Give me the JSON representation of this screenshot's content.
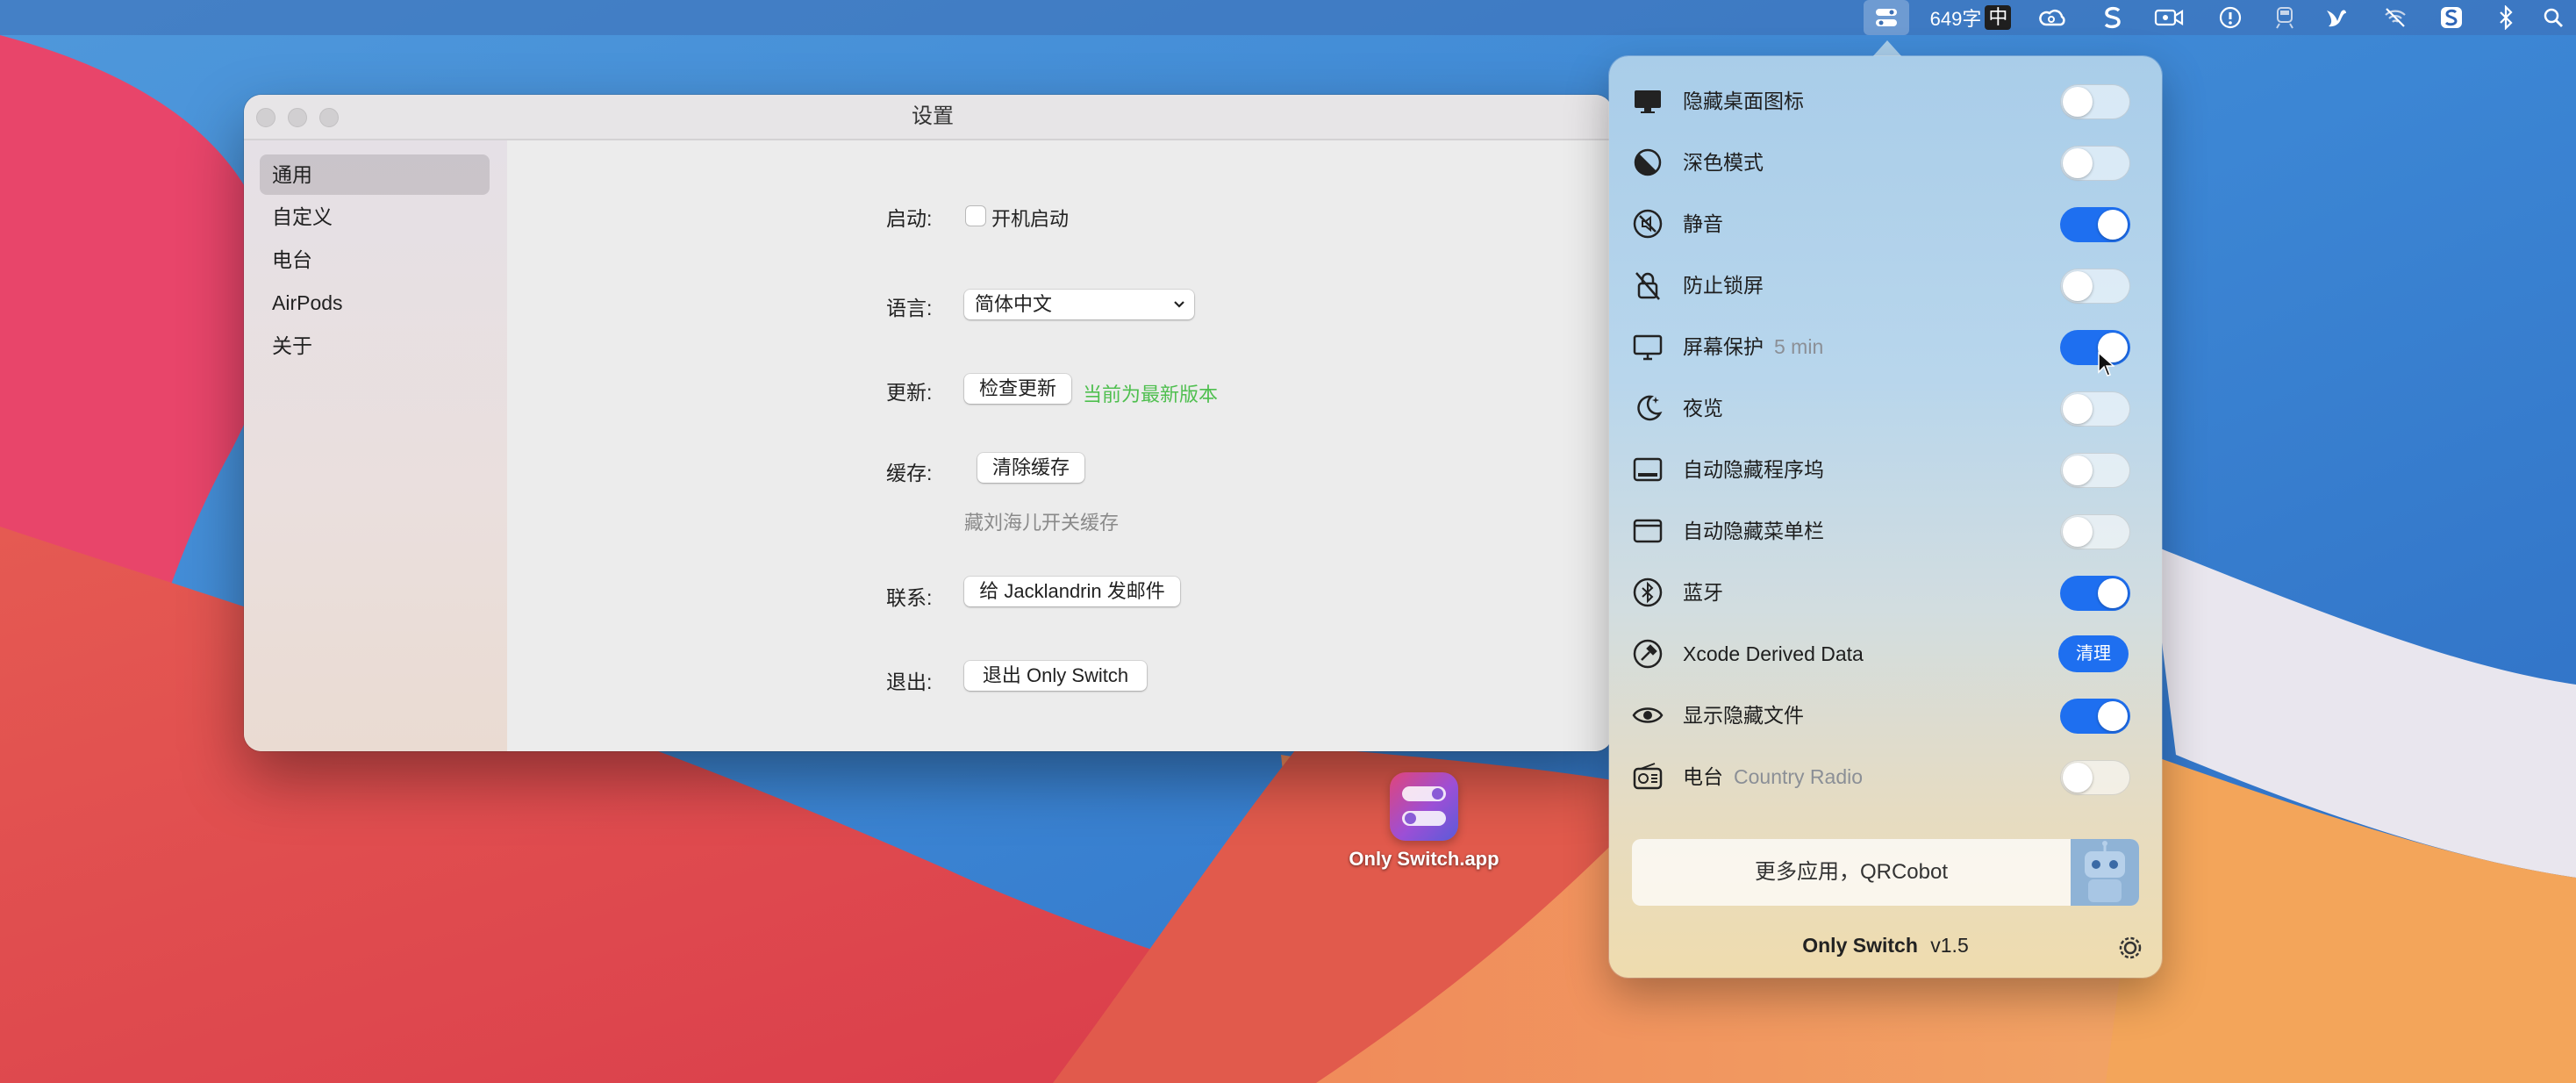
{
  "menubar": {
    "word_count": "649字",
    "input_method": "中",
    "icons": [
      "only-switch-icon",
      "creative-cloud-icon",
      "s-app-icon",
      "facetime-camera-icon",
      "info-circle-icon",
      "train-icon",
      "bird-icon",
      "wifi-off-icon",
      "sogou-icon",
      "bluetooth-icon",
      "search-icon"
    ]
  },
  "window": {
    "title": "设置",
    "sidebar": [
      "通用",
      "自定义",
      "电台",
      "AirPods",
      "关于"
    ],
    "selected_index": 0,
    "rows": {
      "startup_label": "启动:",
      "startup_checkbox": "开机启动",
      "startup_checked": false,
      "language_label": "语言:",
      "language_value": "简体中文",
      "update_label": "更新:",
      "update_button": "检查更新",
      "update_status": "当前为最新版本",
      "cache_label": "缓存:",
      "cache_button": "清除缓存",
      "cache_note": "藏刘海儿开关缓存",
      "contact_label": "联系:",
      "contact_button": "给 Jacklandrin 发邮件",
      "quit_label": "退出:",
      "quit_button": "退出 Only Switch"
    }
  },
  "desktop": {
    "app_name": "Only Switch.app"
  },
  "panel": {
    "items": [
      {
        "label": "隐藏桌面图标",
        "sub": "",
        "on": false,
        "icon": "desktop-icon"
      },
      {
        "label": "深色模式",
        "sub": "",
        "on": false,
        "icon": "dark-mode-icon"
      },
      {
        "label": "静音",
        "sub": "",
        "on": true,
        "icon": "mute-icon"
      },
      {
        "label": "防止锁屏",
        "sub": "",
        "on": false,
        "icon": "lock-off-icon"
      },
      {
        "label": "屏幕保护",
        "sub": "5 min",
        "on": true,
        "icon": "screensaver-icon"
      },
      {
        "label": "夜览",
        "sub": "",
        "on": false,
        "icon": "moon-icon"
      },
      {
        "label": "自动隐藏程序坞",
        "sub": "",
        "on": false,
        "icon": "dock-icon"
      },
      {
        "label": "自动隐藏菜单栏",
        "sub": "",
        "on": false,
        "icon": "menubar-icon"
      },
      {
        "label": "蓝牙",
        "sub": "",
        "on": true,
        "icon": "bluetooth-icon"
      },
      {
        "label": "Xcode Derived Data",
        "sub": "",
        "button": "清理",
        "icon": "hammer-icon"
      },
      {
        "label": "显示隐藏文件",
        "sub": "",
        "on": true,
        "icon": "eye-icon"
      },
      {
        "label": "电台",
        "sub": "Country Radio",
        "on": false,
        "icon": "radio-icon"
      }
    ],
    "promo": "更多应用，QRCobot",
    "footer_name": "Only Switch",
    "footer_version": "v1.5"
  }
}
